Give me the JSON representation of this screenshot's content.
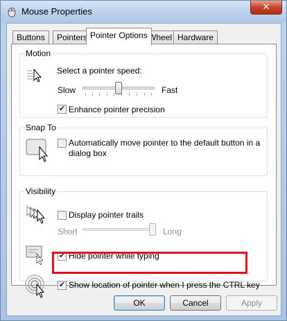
{
  "window": {
    "title": "Mouse Properties",
    "close_glyph": "✕"
  },
  "tabs": [
    {
      "label": "Buttons"
    },
    {
      "label": "Pointers"
    },
    {
      "label": "Pointer Options"
    },
    {
      "label": "Wheel"
    },
    {
      "label": "Hardware"
    }
  ],
  "motion": {
    "title": "Motion",
    "speed_label": "Select a pointer speed:",
    "slow_label": "Slow",
    "fast_label": "Fast",
    "speed_level": 0.5,
    "enhance_label": "Enhance pointer precision",
    "enhance_checked": true
  },
  "snap_to": {
    "title": "Snap To",
    "label_line1": "Automatically move pointer to the default button in a",
    "label_line2": "dialog box",
    "checked": false
  },
  "visibility": {
    "title": "Visibility",
    "trails_label": "Display pointer trails",
    "trails_checked": false,
    "short_label": "Short",
    "long_label": "Long",
    "trail_level": 1.0,
    "hide_label": "Hide pointer while typing",
    "hide_checked": true,
    "show_location_label": "Show location of pointer when I press the CTRL key",
    "show_location_checked": true
  },
  "buttons": {
    "ok": "OK",
    "cancel": "Cancel",
    "apply": "Apply"
  },
  "check_glyph": "✔",
  "colors": {
    "highlight": "#e1121a",
    "accent": "#3c7fb1"
  }
}
